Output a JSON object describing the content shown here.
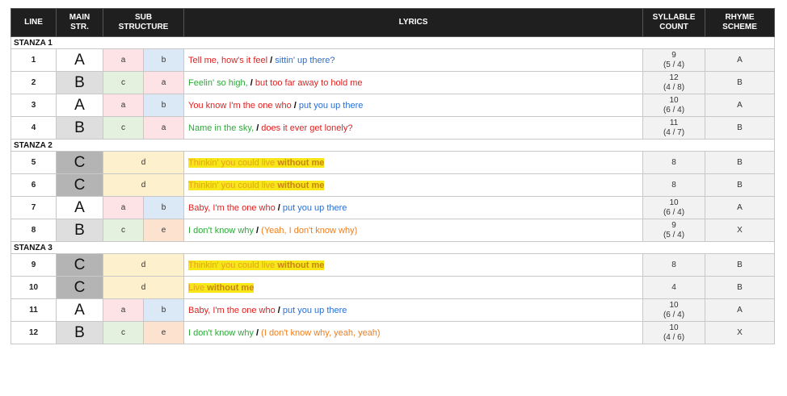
{
  "headers": {
    "line": "LINE",
    "main1": "MAIN",
    "main2": "STR.",
    "sub1": "SUB",
    "sub2": "STRUCTURE",
    "lyrics": "LYRICS",
    "syl1": "SYLLABLE",
    "syl2": "COUNT",
    "rhyme1": "RHYME",
    "rhyme2": "SCHEME"
  },
  "stanzas": [
    {
      "label": "STANZA 1",
      "rows": [
        {
          "line": "1",
          "main": "A",
          "shade": "white",
          "sub": [
            "a",
            "b"
          ],
          "parts": [
            {
              "t": "Tell me, how's it feel ",
              "c": "red"
            },
            {
              "t": "/",
              "c": "slash"
            },
            {
              "t": " sittin' up there?",
              "c": "blue"
            }
          ],
          "syl": "9",
          "split": "(5 / 4)",
          "rhyme": "A"
        },
        {
          "line": "2",
          "main": "B",
          "shade": "light",
          "sub": [
            "c",
            "a"
          ],
          "parts": [
            {
              "t": "Feelin' so high, ",
              "c": "green"
            },
            {
              "t": "/",
              "c": "slash"
            },
            {
              "t": " but too far away to hold me",
              "c": "red"
            }
          ],
          "syl": "12",
          "split": "(4 / 8)",
          "rhyme": "B"
        },
        {
          "line": "3",
          "main": "A",
          "shade": "white",
          "sub": [
            "a",
            "b"
          ],
          "parts": [
            {
              "t": "You know I'm the one who ",
              "c": "red"
            },
            {
              "t": "/",
              "c": "slash"
            },
            {
              "t": " put you up there",
              "c": "blue"
            }
          ],
          "syl": "10",
          "split": "(6 / 4)",
          "rhyme": "A"
        },
        {
          "line": "4",
          "main": "B",
          "shade": "light",
          "sub": [
            "c",
            "a"
          ],
          "parts": [
            {
              "t": "Name in the sky, ",
              "c": "green"
            },
            {
              "t": "/",
              "c": "slash"
            },
            {
              "t": " does it ever get lonely?",
              "c": "red"
            }
          ],
          "syl": "11",
          "split": "(4 / 7)",
          "rhyme": "B"
        }
      ]
    },
    {
      "label": "STANZA 2",
      "rows": [
        {
          "line": "5",
          "main": "C",
          "shade": "dark",
          "sub": [
            "d"
          ],
          "hl": true,
          "parts": [
            {
              "t": "Thinkin' you could live ",
              "c": "hl"
            },
            {
              "t": "without me",
              "c": "hlb"
            }
          ],
          "syl": "8",
          "split": "",
          "rhyme": "B"
        },
        {
          "line": "6",
          "main": "C",
          "shade": "dark",
          "sub": [
            "d"
          ],
          "hl": true,
          "parts": [
            {
              "t": "Thinkin' you could live ",
              "c": "hl"
            },
            {
              "t": "without me",
              "c": "hlb"
            }
          ],
          "syl": "8",
          "split": "",
          "rhyme": "B"
        },
        {
          "line": "7",
          "main": "A",
          "shade": "white",
          "sub": [
            "a",
            "b"
          ],
          "parts": [
            {
              "t": "Baby, I'm the one who ",
              "c": "red"
            },
            {
              "t": "/",
              "c": "slash"
            },
            {
              "t": " put you up there",
              "c": "blue"
            }
          ],
          "syl": "10",
          "split": "(6 / 4)",
          "rhyme": "A"
        },
        {
          "line": "8",
          "main": "B",
          "shade": "light",
          "sub": [
            "c",
            "e"
          ],
          "parts": [
            {
              "t": "I don't know why ",
              "c": "green"
            },
            {
              "t": "/",
              "c": "slash"
            },
            {
              "t": " (Yeah, I don't know why)",
              "c": "orange"
            }
          ],
          "syl": "9",
          "split": "(5 / 4)",
          "rhyme": "X"
        }
      ]
    },
    {
      "label": "STANZA 3",
      "rows": [
        {
          "line": "9",
          "main": "C",
          "shade": "dark",
          "sub": [
            "d"
          ],
          "hl": true,
          "parts": [
            {
              "t": "Thinkin' you could live ",
              "c": "hl"
            },
            {
              "t": "without me",
              "c": "hlb"
            }
          ],
          "syl": "8",
          "split": "",
          "rhyme": "B"
        },
        {
          "line": "10",
          "main": "C",
          "shade": "dark",
          "sub": [
            "d"
          ],
          "hl": true,
          "parts": [
            {
              "t": "Live ",
              "c": "hl"
            },
            {
              "t": "without me",
              "c": "hlb"
            }
          ],
          "syl": "4",
          "split": "",
          "rhyme": "B"
        },
        {
          "line": "11",
          "main": "A",
          "shade": "white",
          "sub": [
            "a",
            "b"
          ],
          "parts": [
            {
              "t": "Baby, I'm the one who ",
              "c": "red"
            },
            {
              "t": "/",
              "c": "slash"
            },
            {
              "t": " put you up there",
              "c": "blue"
            }
          ],
          "syl": "10",
          "split": "(6 / 4)",
          "rhyme": "A"
        },
        {
          "line": "12",
          "main": "B",
          "shade": "light",
          "sub": [
            "c",
            "e"
          ],
          "parts": [
            {
              "t": "I don't know why ",
              "c": "green"
            },
            {
              "t": "/",
              "c": "slash"
            },
            {
              "t": " (I don't know why, yeah, yeah)",
              "c": "orange"
            }
          ],
          "syl": "10",
          "split": "(4 / 6)",
          "rhyme": "X"
        }
      ]
    }
  ],
  "colors": {
    "header_bg": "#1f1f1f",
    "red": "#e02020",
    "blue": "#2a6fd0",
    "green": "#2ea83a",
    "orange": "#f07e1d",
    "highlight": "#f7e718"
  }
}
